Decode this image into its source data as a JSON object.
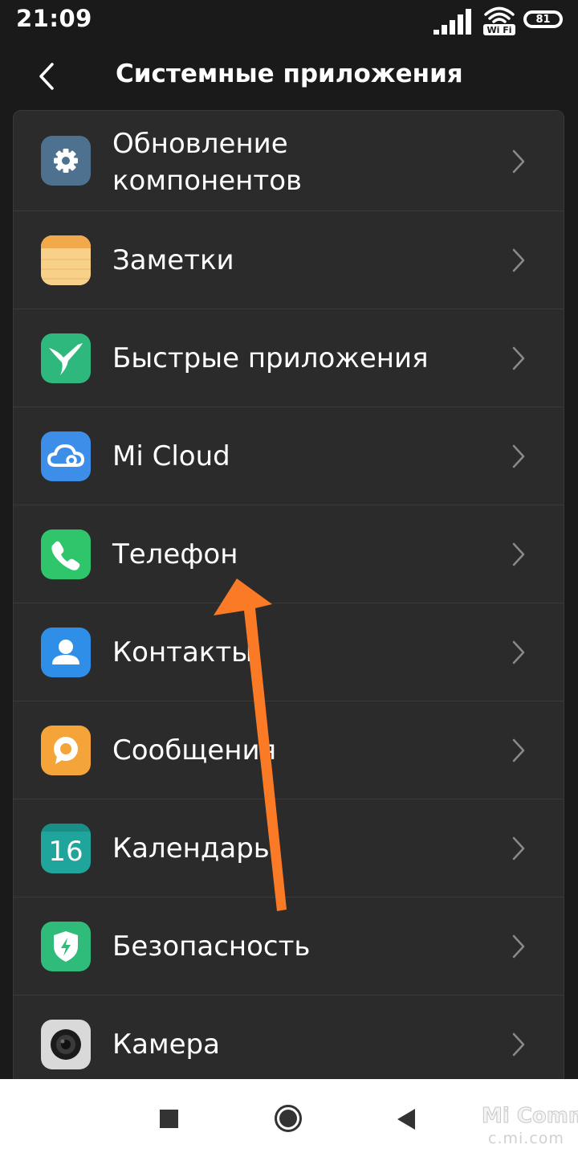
{
  "status_bar": {
    "time": "21:09",
    "battery_level": "81",
    "wifi_label": "Wi Fi",
    "signal_icon": "signal-bars-icon",
    "wifi_icon": "wifi-icon"
  },
  "header": {
    "back_icon": "chevron-left-icon",
    "title": "Системные приложения"
  },
  "apps": [
    {
      "label_line1": "Обновление",
      "label_line2": "компонентов",
      "icon": "gear-icon",
      "icon_color": "#4f7190"
    },
    {
      "label": "Заметки",
      "icon": "notes-icon",
      "icon_color": "#f5c163"
    },
    {
      "label": "Быстрые приложения",
      "icon": "hummingbird-icon",
      "icon_color": "#2fb87d"
    },
    {
      "label": "Mi Cloud",
      "icon": "cloud-icon",
      "icon_color": "#3d8ee8"
    },
    {
      "label": "Телефон",
      "icon": "phone-icon",
      "icon_color": "#2fc66b"
    },
    {
      "label": "Контакты",
      "icon": "contact-icon",
      "icon_color": "#2f8fe8"
    },
    {
      "label": "Сообщения",
      "icon": "message-icon",
      "icon_color": "#f5a43a"
    },
    {
      "label": "Календарь",
      "icon": "calendar-icon",
      "icon_color": "#1fa59c",
      "icon_text": "16"
    },
    {
      "label": "Безопасность",
      "icon": "shield-icon",
      "icon_color": "#2fbb7a"
    },
    {
      "label": "Камера",
      "icon": "camera-icon",
      "icon_color": "#d9d9d9"
    }
  ],
  "annotation": {
    "arrow_icon": "annotation-arrow-icon",
    "arrow_color": "#fb7a25"
  },
  "navigation_bar": {
    "recents_icon": "square-icon",
    "home_icon": "circle-icon",
    "back_icon": "triangle-back-icon"
  },
  "watermark": {
    "brand": "Mi Comm",
    "url": "c.mi.com"
  }
}
